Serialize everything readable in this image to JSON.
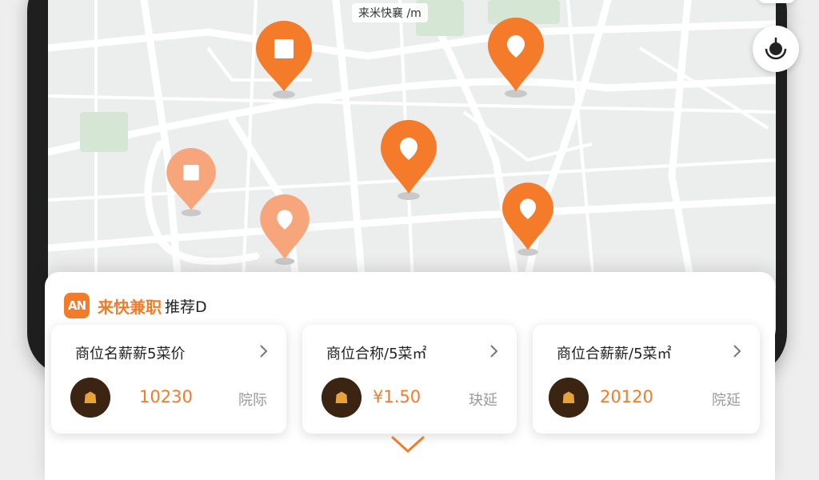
{
  "map": {
    "label": "来米快襄 /m",
    "pins": [
      {
        "icon": "square-icon",
        "shade": "strong"
      },
      {
        "icon": "drop-icon",
        "shade": "strong"
      },
      {
        "icon": "square-icon",
        "shade": "light"
      },
      {
        "icon": "drop-icon",
        "shade": "strong"
      },
      {
        "icon": "drop-icon",
        "shade": "light"
      },
      {
        "icon": "drop-icon",
        "shade": "strong"
      }
    ]
  },
  "controls": {
    "locate_icon": "location-target-icon"
  },
  "sheet": {
    "logo_text": "AN",
    "brand": "来快兼职",
    "brand_suffix": "推荐D",
    "cards": [
      {
        "title": "商位名薪薪5菜价",
        "price": "10230",
        "tag": "院际"
      },
      {
        "title": "商位合称/5菜㎡",
        "price": "¥1.50",
        "tag": "玦延"
      },
      {
        "title": "商位合薪薪/5菜㎡",
        "price": "20120",
        "tag": "院延"
      }
    ]
  },
  "colors": {
    "accent": "#f47b2a",
    "accent_light": "#f7a57a",
    "map_bg": "#eceded"
  }
}
